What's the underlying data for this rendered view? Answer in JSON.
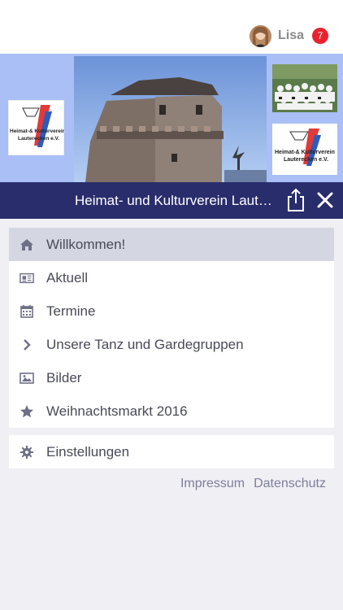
{
  "header": {
    "user_name": "Lisa",
    "notification_count": "7"
  },
  "banner": {
    "logo_text_line1": "Heimat-& Kulturverein",
    "logo_text_line2": "Lauterecken e.V."
  },
  "titlebar": {
    "title": "Heimat- und Kulturverein Lauterecken e.V."
  },
  "menu": {
    "items": [
      {
        "label": "Willkommen!",
        "icon": "home-icon",
        "active": true
      },
      {
        "label": "Aktuell",
        "icon": "newspaper-icon"
      },
      {
        "label": "Termine",
        "icon": "calendar-icon"
      },
      {
        "label": "Unsere Tanz und Gardegruppen",
        "icon": "chevron-right-icon"
      },
      {
        "label": "Bilder",
        "icon": "image-icon"
      },
      {
        "label": "Weihnachtsmarkt 2016",
        "icon": "star-icon"
      }
    ],
    "settings_label": "Einstellungen"
  },
  "footer": {
    "impressum": "Impressum",
    "datenschutz": "Datenschutz"
  },
  "colors": {
    "titlebar_bg": "#2a2d6c",
    "active_item_bg": "#d4d6e2",
    "badge_red": "#e8232f",
    "icon_gray": "#6e7086",
    "page_bg": "#efeff4"
  }
}
